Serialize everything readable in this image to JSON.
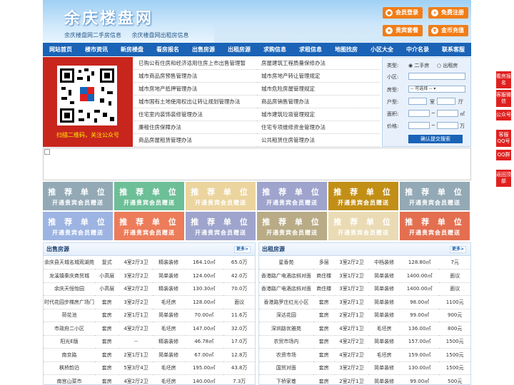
{
  "header": {
    "logo": "余庆楼盘网",
    "sub1": "余庆楼盘网二手房信息",
    "sub2": "余庆楼盘网出租房信息",
    "btn_login": "会员登录",
    "btn_register": "免费注册",
    "btn_package": "贵宾套餐",
    "btn_recharge": "金币充值"
  },
  "nav": [
    "网站首页",
    "楼市资讯",
    "新房楼盘",
    "看房报名",
    "出售房源",
    "出租房源",
    "求购信息",
    "求租信息",
    "地图找房",
    "小区大全",
    "中介名录",
    "联系客服"
  ],
  "qr": {
    "caption": "扫描二维码，关注公众号"
  },
  "links_left": [
    "已购公有住房和经济适用住房上市出售管理暂",
    "城市商品房预售管理办法",
    "城市房地产抵押管理办法",
    "城市国有土地使用权出让转让规划管理办法",
    "住宅室内装饰装修管理办法",
    "廉租住房保障办法",
    "商品房屋租赁管理办法"
  ],
  "links_right": [
    "房屋建筑工程质量保修办法",
    "城市房地产转让管理规定",
    "城市危险房屋管理规定",
    "商品房销售管理办法",
    "城市建筑垃圾管理规定",
    "住宅专项维修资金管理办法",
    "公共租赁住房管理办法"
  ],
  "search": {
    "type_label": "类型:",
    "opt1": "二手房",
    "opt2": "出租房",
    "area_label": "小区:",
    "room_label": "房型:",
    "room_select": "-- 可选择 --",
    "layout_label": "户型:",
    "shi": "室",
    "ting": "厅",
    "size_label": "面积:",
    "size_unit": "㎡",
    "tilde": "~",
    "price_label": "价格:",
    "price_unit": "万",
    "submit": "确认提交搜索"
  },
  "ads": {
    "t1": "推 荐 单 位",
    "t2": "开通贵宾会员赠送"
  },
  "sale": {
    "title": "出售房源",
    "more": "更多>",
    "rows": [
      [
        "余庆县天城名城观湖苑",
        "复式",
        "4室2厅3卫",
        "精装装修",
        "164.10㎡",
        "65.0万"
      ],
      [
        "龙溪镇秦庆商贸城",
        "小高层",
        "3室2厅2卫",
        "简单装修",
        "124.00㎡",
        "42.0万"
      ],
      [
        "余庆天恒怡园",
        "小高层",
        "4室2厅2卫",
        "精装装修",
        "130.30㎡",
        "70.0万"
      ],
      [
        "时代花园步梯房广场门",
        "套房",
        "3室2厅2卫",
        "毛坯房",
        "128.00㎡",
        "面议"
      ],
      [
        "荷花池",
        "套房",
        "2室1厅1卫",
        "简单装修",
        "70.00㎡",
        "11.6万"
      ],
      [
        "市政府二小区",
        "套房",
        "4室2厅2卫",
        "毛坯房",
        "147.00㎡",
        "32.0万"
      ],
      [
        "阳光E版",
        "套房",
        "--",
        "精装装修",
        "46.78㎡",
        "17.0万"
      ],
      [
        "南京路",
        "套房",
        "2室1厅1卫",
        "简单装修",
        "67.00㎡",
        "12.8万"
      ],
      [
        "枫桥韵泊",
        "套房",
        "5室3厅4卫",
        "毛坯房",
        "195.00㎡",
        "43.8万"
      ],
      [
        "南宫山菜市",
        "套房",
        "4室2厅2卫",
        "毛坯房",
        "140.00㎡",
        "7.3万"
      ]
    ]
  },
  "rent": {
    "title": "出租房源",
    "more": "更多>",
    "rows": [
      [
        "星香苑",
        "多层",
        "3室2厅2卫",
        "中档装修",
        "128.80㎡",
        "7元"
      ],
      [
        "香港路广电酒店斜对面",
        "商住楼",
        "3室1厅2卫",
        "简单装修",
        "1400.00㎡",
        "面议"
      ],
      [
        "香港路广电酒店斜对面",
        "商住楼",
        "3室1厅2卫",
        "简单装修",
        "1400.00㎡",
        "面议"
      ],
      [
        "香港路罗庄红光小区",
        "套房",
        "3室2厅1卫",
        "简单装修",
        "98.00㎡",
        "1100元"
      ],
      [
        "深达花园",
        "套房",
        "2室2厅1卫",
        "简单装修",
        "99.00㎡",
        "900元"
      ],
      [
        "深圳路优雅苑",
        "套房",
        "4室2厅1卫",
        "毛坯房",
        "136.00㎡",
        "800元"
      ],
      [
        "农贸市场内",
        "套房",
        "4室2厅2卫",
        "简单装修",
        "157.00㎡",
        "1500元"
      ],
      [
        "农资市场",
        "套房",
        "4室2厅2卫",
        "毛坯房",
        "159.00㎡",
        "1500元"
      ],
      [
        "国贸对面",
        "套房",
        "3室2厅2卫",
        "简单装修",
        "130.00㎡",
        "1500元"
      ],
      [
        "下桥家巷",
        "套房",
        "2室2厅1卫",
        "简单装修",
        "99.00㎡",
        "500元"
      ]
    ]
  },
  "side": [
    "看房报名",
    "客服微信",
    "公众号",
    "客服QQ号",
    "QQ群",
    "返回顶部"
  ],
  "colors": {
    "nav": "#1a63b6",
    "orange": "#f07d18",
    "red": "#e02020"
  }
}
